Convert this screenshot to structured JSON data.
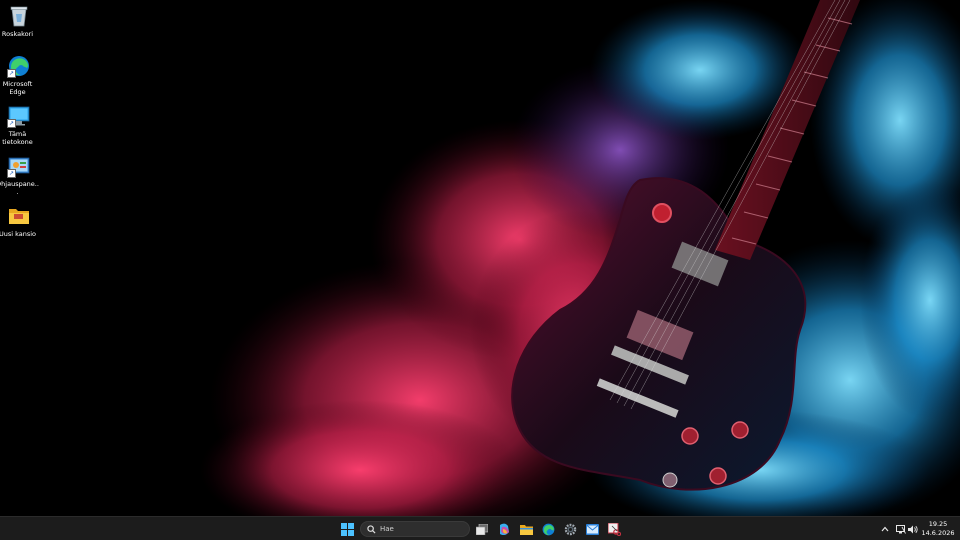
{
  "desktop": {
    "icons": [
      {
        "label": "Roskakori",
        "icon": "recycle-bin-icon"
      },
      {
        "label": "Microsoft Edge",
        "icon": "edge-icon"
      },
      {
        "label": "Tämä tietokone",
        "icon": "this-pc-icon"
      },
      {
        "label": "Ohjauspane...",
        "icon": "control-panel-icon"
      },
      {
        "label": "Uusi kansio",
        "icon": "folder-icon"
      }
    ]
  },
  "taskbar": {
    "search_placeholder": "Hae",
    "pinned": [
      {
        "icon": "start-icon"
      },
      {
        "icon": "task-view-icon"
      },
      {
        "icon": "copilot-icon"
      },
      {
        "icon": "file-explorer-icon"
      },
      {
        "icon": "edge-icon"
      },
      {
        "icon": "settings-icon"
      },
      {
        "icon": "mail-icon"
      },
      {
        "icon": "snipping-tool-icon"
      }
    ],
    "tray": {
      "time": "19.25",
      "date": "14.6.2026"
    }
  },
  "colors": {
    "taskbar_bg": "#1c1c1c",
    "smoke_pink": "#e8305c",
    "smoke_blue": "#2aa8e0"
  }
}
